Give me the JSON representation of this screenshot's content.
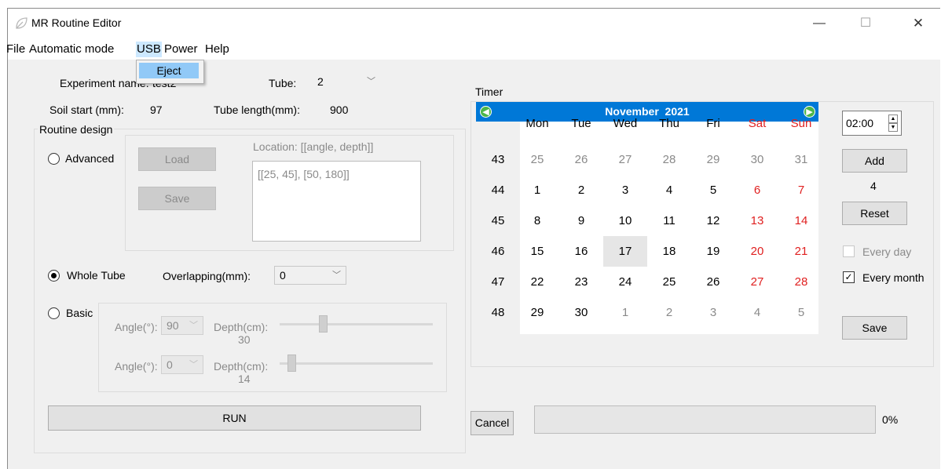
{
  "window": {
    "title": "MR Routine Editor",
    "controls": {
      "minimize": "—",
      "maximize": "☐",
      "close": "✕"
    }
  },
  "menu": {
    "items": [
      "File",
      "Automatic mode",
      "USB",
      "Power",
      "Help"
    ],
    "usb_dropdown": [
      "Eject"
    ]
  },
  "experiment": {
    "name_label": "Experiment name:",
    "name_value": "test2",
    "tube_label": "Tube:",
    "tube_value": "2",
    "soil_start_label": "Soil start (mm):",
    "soil_start_value": "97",
    "tube_length_label": "Tube length(mm):",
    "tube_length_value": "900"
  },
  "routine": {
    "group_title": "Routine design",
    "advanced_label": "Advanced",
    "load_label": "Load",
    "save_label": "Save",
    "location_label": "Location: [[angle, depth]]",
    "location_value": "[[25, 45], [50, 180]]",
    "whole_tube_label": "Whole Tube",
    "overlapping_label": "Overlapping(mm):",
    "overlapping_value": "0",
    "basic_label": "Basic",
    "selected_mode": "Whole Tube",
    "angle_label": "Angle(°):",
    "depth_label": "Depth(cm):",
    "row1": {
      "angle": "90",
      "depth": "30"
    },
    "row2": {
      "angle": "0",
      "depth": "14"
    },
    "run_label": "RUN"
  },
  "timer": {
    "group_title": "Timer",
    "month": "November",
    "year": "2021",
    "days_of_week": [
      "Mon",
      "Tue",
      "Wed",
      "Thu",
      "Fri",
      "Sat",
      "Sun"
    ],
    "weeks": [
      {
        "num": "43",
        "days": [
          "25",
          "26",
          "27",
          "28",
          "29",
          "30",
          "31"
        ]
      },
      {
        "num": "44",
        "days": [
          "1",
          "2",
          "3",
          "4",
          "5",
          "6",
          "7"
        ]
      },
      {
        "num": "45",
        "days": [
          "8",
          "9",
          "10",
          "11",
          "12",
          "13",
          "14"
        ]
      },
      {
        "num": "46",
        "days": [
          "15",
          "16",
          "17",
          "18",
          "19",
          "20",
          "21"
        ]
      },
      {
        "num": "47",
        "days": [
          "22",
          "23",
          "24",
          "25",
          "26",
          "27",
          "28"
        ]
      },
      {
        "num": "48",
        "days": [
          "29",
          "30",
          "1",
          "2",
          "3",
          "4",
          "5"
        ]
      }
    ],
    "time_value": "02:00",
    "add_label": "Add",
    "count": "4",
    "reset_label": "Reset",
    "every_day_label": "Every day",
    "every_month_label": "Every month",
    "every_day_checked": false,
    "every_month_checked": true,
    "save_label": "Save"
  },
  "bottom": {
    "cancel_label": "Cancel",
    "progress_text": "0%",
    "progress_value": 0
  },
  "colors": {
    "calendar_header": "#0078d7",
    "weekend": "#e02020",
    "menu_highlight": "#cce8ff",
    "dropdown_highlight": "#91c9f7"
  }
}
